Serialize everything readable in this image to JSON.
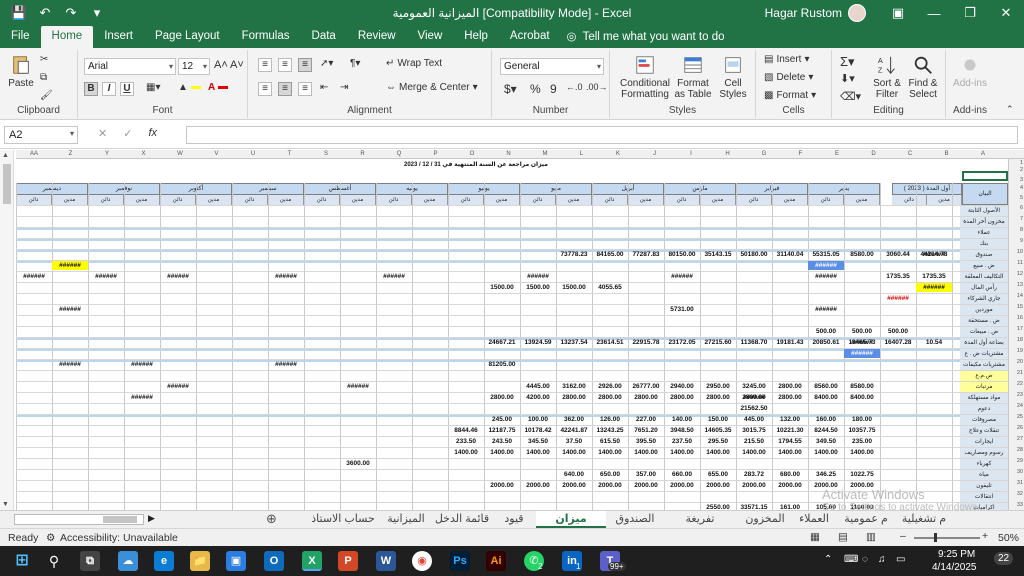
{
  "window": {
    "title": "الميزانية العمومية [Compatibility Mode] - Excel",
    "user": "Hagar Rustom",
    "qat_save_icon": "save-icon",
    "qat_undo_icon": "undo-icon",
    "qat_customize_icon": "customize-icon"
  },
  "ribbon_tabs": [
    "File",
    "Home",
    "Insert",
    "Page Layout",
    "Formulas",
    "Data",
    "Review",
    "View",
    "Help",
    "Acrobat"
  ],
  "tell_me": "Tell me what you want to do",
  "ribbon": {
    "clipboard": {
      "paste": "Paste",
      "label": "Clipboard"
    },
    "font": {
      "name": "Arial",
      "size": "12",
      "label": "Font"
    },
    "alignment": {
      "wrap": "Wrap Text",
      "merge": "Merge & Center",
      "label": "Alignment"
    },
    "number": {
      "format": "General",
      "label": "Number"
    },
    "styles": {
      "cond": "Conditional Formatting",
      "table": "Format as Table",
      "cell": "Cell Styles",
      "label": "Styles"
    },
    "cells": {
      "insert": "Insert",
      "delete": "Delete",
      "format": "Format",
      "label": "Cells"
    },
    "editing": {
      "sort": "Sort & Filter",
      "find": "Find & Select",
      "label": "Editing"
    },
    "addins": {
      "btn": "Add-ins",
      "label": "Add-ins"
    }
  },
  "namebox": "A2",
  "columns": [
    "AA",
    "Z",
    "Y",
    "X",
    "W",
    "V",
    "U",
    "T",
    "S",
    "R",
    "Q",
    "P",
    "O",
    "N",
    "M",
    "L",
    "K",
    "J",
    "I",
    "H",
    "G",
    "F",
    "E",
    "D",
    "C",
    "B",
    "A"
  ],
  "rows": [
    "1",
    "2",
    "3",
    "4",
    "5",
    "6",
    "7",
    "8",
    "9",
    "10",
    "11",
    "12",
    "13",
    "14",
    "15",
    "16",
    "17",
    "18",
    "19",
    "20",
    "21",
    "22",
    "23",
    "24",
    "25",
    "26",
    "27",
    "28",
    "29",
    "30",
    "31",
    "32",
    "33"
  ],
  "sheet_title": "ميزان مراجعة عن السنة المنتهية في 31 / 12 / 2023",
  "year_header": "أول المدة ( 2023 )",
  "months": [
    "ديسمبر",
    "نوفمبر",
    "أكتوبر",
    "سبتمبر",
    "أغسطس",
    "يوليه",
    "يونيو",
    "مايو",
    "أبريل",
    "مارس",
    "فبراير",
    "يناير"
  ],
  "debit": "مدين",
  "credit": "دائن",
  "statement": "البيان",
  "row_labels": [
    "الأصول الثابتة",
    "مخزون أخر المدة",
    "عملاء",
    "بنك",
    "صندوق",
    "ض . مبيع",
    "التكاليف المعلقة",
    "رأس المال",
    "جاري الشركاء",
    "موردين",
    "ض . مستحقة",
    "ض . مبيعات",
    "بضاعة أول المدة",
    "مشتريات ض . ع",
    "مشتريات مكيفات",
    "ض.م.ع",
    "مرتبات",
    "مواد مستهلكة",
    "دعوم",
    "مصروفات",
    "تنقلات وعلاج",
    "ايجارات",
    "رسوم ومصاريف",
    "كهرباء",
    "مياه",
    "تليفون",
    "انتقالات",
    "اكراميات",
    "مصاريف متنوعة"
  ],
  "cells": {
    "r8": [
      "44214.78",
      "3060.44",
      "8580.00",
      "55315.05",
      "31140.04",
      "50180.00",
      "35143.15",
      "80150.00",
      "77287.83",
      "84165.00",
      "73778.23"
    ],
    "r10": [
      "1735.35",
      "1735.35"
    ],
    "r11": [
      "4055.65",
      "1500.00",
      "1500.00",
      "1500.00"
    ],
    "r13": [
      "5731.00"
    ],
    "r15": [
      "500.00",
      "500.00",
      "500.00"
    ],
    "r16": [
      "10.54",
      "16407.28",
      "13465.73",
      "20850.61",
      "19181.43",
      "11368.70",
      "27215.60",
      "23172.05",
      "22915.78",
      "23614.51",
      "13237.54",
      "13924.59",
      "24667.21"
    ],
    "r18": [
      "81205.00"
    ],
    "r20": [
      "8580.00",
      "8560.00",
      "2800.00",
      "3245.00",
      "2950.00",
      "2940.00",
      "26777.00",
      "2926.00",
      "3162.00",
      "4445.00"
    ],
    "r21": [
      "8400.00",
      "8400.00",
      "2800.00",
      "2800.00",
      "2800.00",
      "2800.00",
      "2800.00",
      "2800.00",
      "2800.00",
      "4200.00",
      "2800.00"
    ],
    "r22": [
      "21562.50"
    ],
    "r23": [
      "180.00",
      "160.00",
      "132.00",
      "445.00",
      "150.00",
      "140.00",
      "227.00",
      "126.00",
      "362.00",
      "100.00",
      "245.00"
    ],
    "r24": [
      "10357.75",
      "8244.50",
      "10221.30",
      "3015.75",
      "14605.35",
      "3948.50",
      "7651.20",
      "13243.25",
      "42241.87",
      "10178.42",
      "12187.75",
      "8844.46"
    ],
    "r25": [
      "235.00",
      "349.50",
      "1794.55",
      "215.50",
      "295.50",
      "237.50",
      "395.50",
      "615.50",
      "37.50",
      "345.50",
      "243.50",
      "233.50"
    ],
    "r26": [
      "1400.00",
      "1400.00",
      "1400.00",
      "1400.00",
      "1400.00",
      "1400.00",
      "1400.00",
      "1400.00",
      "1400.00",
      "1400.00",
      "1400.00",
      "1400.00"
    ],
    "r27": [
      "3600.00"
    ],
    "r28": [
      "1022.75",
      "346.25",
      "680.00",
      "283.72",
      "655.00",
      "660.00",
      "357.00",
      "650.00",
      "640.00"
    ],
    "r29": [
      "2000.00",
      "2000.00",
      "2000.00",
      "2000.00",
      "2000.00",
      "2000.00",
      "2000.00",
      "2000.00",
      "2000.00",
      "2000.00",
      "2000.00"
    ],
    "r31": [
      "1100.00",
      "105.00",
      "161.00",
      "33571.15",
      "2550.00"
    ]
  },
  "overflow": "######",
  "sheet_tabs": [
    "حساب الاستاذ",
    "الميزانية",
    "قائمة الدخل",
    "قيود",
    "ميزان المراجعة",
    "الصندوق",
    "تفريغة الاقرارات",
    "المخزون",
    "العملاء",
    "م عمومية",
    "م تشغيلية"
  ],
  "active_sheet": "ميزان المراجعة",
  "status": {
    "ready": "Ready",
    "accessibility": "Accessibility: Unavailable",
    "zoom": "50%"
  },
  "watermark": {
    "line1": "Activate Windows",
    "line2": "Go to Settings to activate Windows."
  },
  "taskbar": {
    "time": "9:25 PM",
    "date": "4/14/2025",
    "badge_whatsapp": "2",
    "badge_linkedin": "1",
    "badge_other": "99+",
    "notif": "22"
  },
  "colors": {
    "excel_green": "#217346",
    "header_blue": "#c5d9f1",
    "yellow": "#ffff00"
  }
}
